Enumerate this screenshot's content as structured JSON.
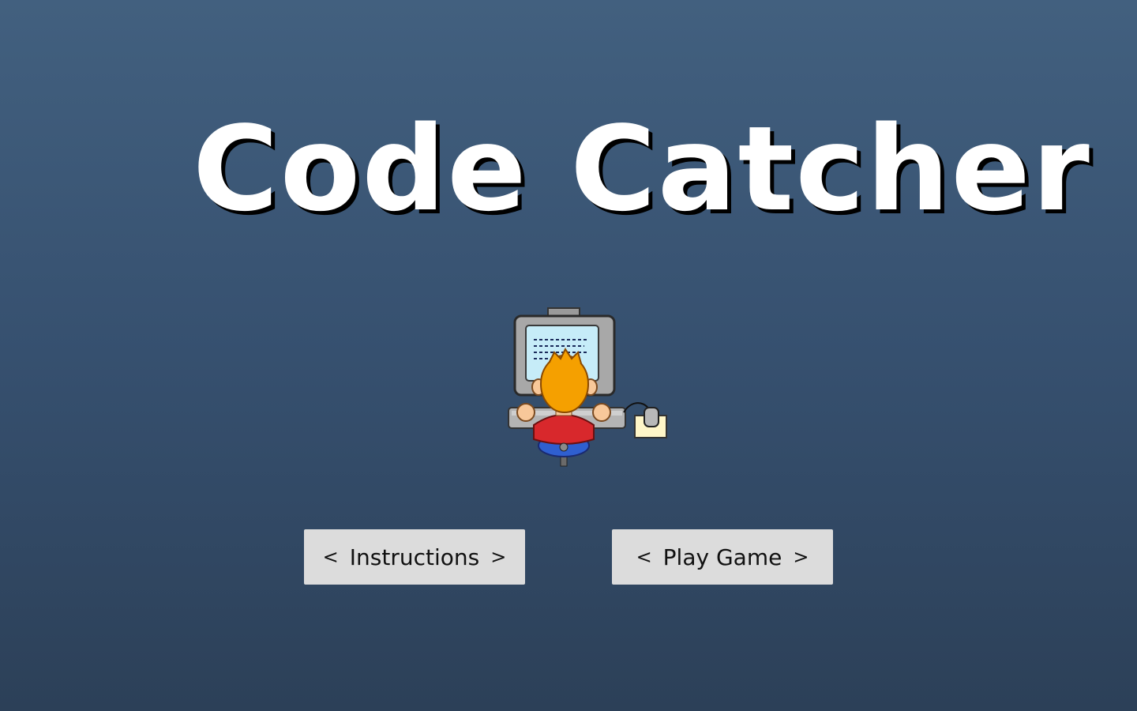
{
  "app": {
    "title": "Code Catcher"
  },
  "menu": {
    "instructions_label": "Instructions",
    "play_label": "Play Game",
    "chevron_left": "<",
    "chevron_right": ">"
  },
  "hero": {
    "icon": "programmer-at-computer-icon"
  },
  "colors": {
    "background_top": "#42607f",
    "background_bottom": "#2c4058",
    "title_text": "#ffffff",
    "title_shadow": "#000000",
    "button_bg": "#dcdcdc",
    "button_text": "#111111"
  }
}
